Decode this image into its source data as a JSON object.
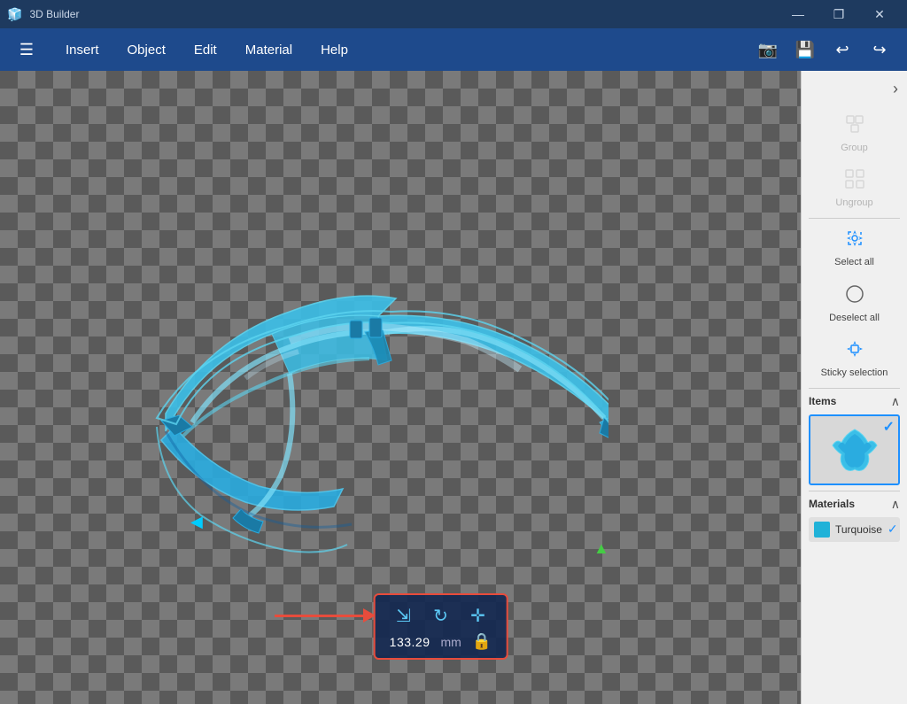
{
  "app": {
    "title": "3D Builder",
    "window_controls": {
      "minimize": "—",
      "maximize": "❐",
      "close": "✕"
    }
  },
  "menubar": {
    "items": [
      "Insert",
      "Object",
      "Edit",
      "Material",
      "Help"
    ],
    "icons": {
      "camera": "📷",
      "save": "💾",
      "undo": "↩",
      "redo": "↪"
    }
  },
  "sidebar": {
    "collapse_label": "›",
    "group_label": "Group",
    "ungroup_label": "Ungroup",
    "select_all_label": "Select all",
    "deselect_all_label": "Deselect all",
    "sticky_selection_label": "Sticky selection",
    "items_label": "Items",
    "materials_label": "Materials",
    "material_name": "Turquoise",
    "material_color": "#20b2d8"
  },
  "toolbar": {
    "value": "133.29",
    "unit": "mm"
  },
  "colors": {
    "accent_blue": "#1e90ff",
    "turquoise": "#20b2d8",
    "selection_border": "#5bc8f5"
  }
}
